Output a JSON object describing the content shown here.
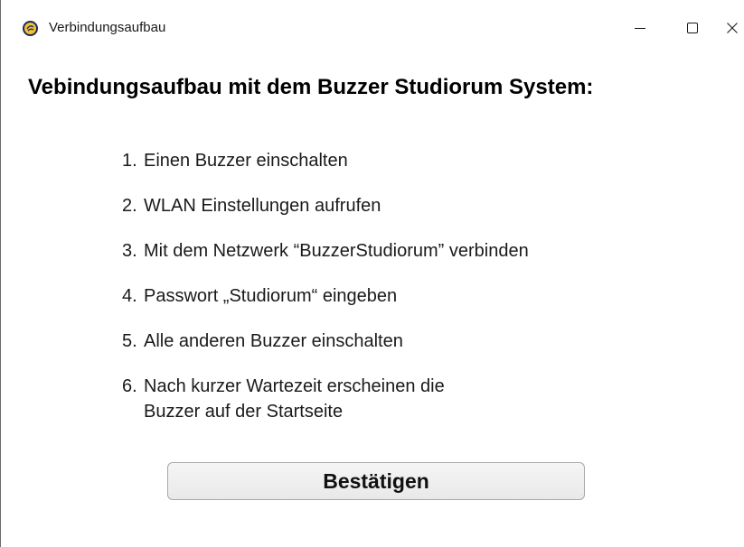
{
  "window": {
    "title": "Verbindungsaufbau",
    "app_icon": "buzzer-logo-icon",
    "controls": {
      "minimize_icon": "minimize-icon",
      "maximize_icon": "maximize-icon",
      "close_icon": "close-icon"
    }
  },
  "content": {
    "heading": "Vebindungsaufbau mit dem Buzzer Studiorum System:",
    "steps": [
      {
        "num": "1.",
        "text": "Einen Buzzer einschalten"
      },
      {
        "num": "2.",
        "text": "WLAN Einstellungen aufrufen"
      },
      {
        "num": "3.",
        "text": "Mit dem Netzwerk “BuzzerStudiorum” verbinden"
      },
      {
        "num": "4.",
        "text": "Passwort „Studiorum“ eingeben"
      },
      {
        "num": "5.",
        "text": "Alle anderen Buzzer einschalten"
      },
      {
        "num": "6.",
        "text": "Nach kurzer Wartezeit erscheinen die",
        "text_cont": "Buzzer auf der Startseite"
      }
    ],
    "confirm_label": "Bestätigen"
  },
  "colors": {
    "icon_fill": "#f2c230",
    "icon_ring": "#1e2a5c",
    "button_border": "#a9a9a9"
  }
}
